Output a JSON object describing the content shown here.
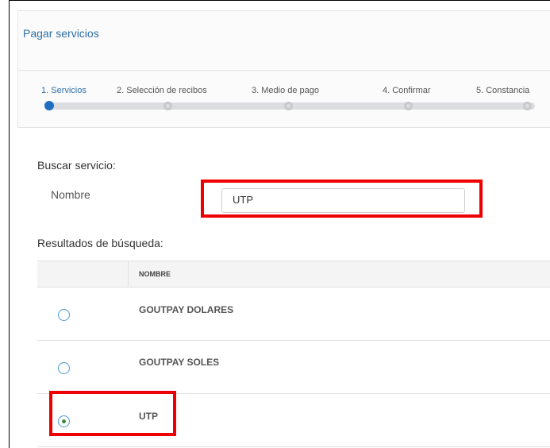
{
  "page": {
    "title": "Pagar servicios"
  },
  "stepper": {
    "steps": [
      {
        "label": "1. Servicios",
        "active": true
      },
      {
        "label": "2. Selección de recibos",
        "active": false
      },
      {
        "label": "3. Medio de pago",
        "active": false
      },
      {
        "label": "4. Confirmar",
        "active": false
      },
      {
        "label": "5. Constancia",
        "active": false
      }
    ]
  },
  "search": {
    "heading": "Buscar servicio:",
    "name_label": "Nombre",
    "name_value": "UTP"
  },
  "results": {
    "heading": "Resultados de búsqueda:",
    "column_header": "NOMBRE",
    "rows": [
      {
        "name": "GOUTPAY DOLARES",
        "selected": false
      },
      {
        "name": "GOUTPAY SOLES",
        "selected": false
      },
      {
        "name": "UTP",
        "selected": true
      }
    ]
  },
  "colors": {
    "accent": "#2e6fa8",
    "highlight": "#ee0000",
    "radio_border": "#4a9ad4",
    "radio_checked": "#3a8a3a"
  }
}
